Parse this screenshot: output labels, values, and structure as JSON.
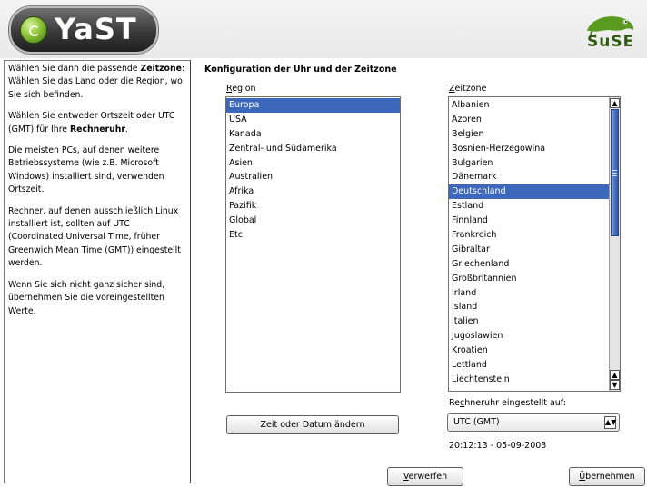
{
  "app": {
    "logo_text": "YaST",
    "brand_text": "SuSE"
  },
  "help": {
    "p1_pre": "Wählen Sie dann die passende ",
    "p1_bold": "Zeitzone",
    "p1_post": ": Wählen Sie das Land oder die Region, wo Sie sich befinden.",
    "p2_pre": "Wählen Sie entweder Ortszeit oder UTC (GMT) für Ihre ",
    "p2_bold": "Rechneruhr",
    "p2_post": ".",
    "p3": "Die meisten PCs, auf denen weitere Betriebssysteme (wie z.B. Microsoft Windows) installiert sind, verwenden Ortszeit.",
    "p4": "Rechner, auf denen ausschließlich Linux installiert ist, sollten auf UTC (Coordinated Universal Time, früher Greenwich Mean Time (GMT)) eingestellt werden.",
    "p5": "Wenn Sie sich nicht ganz sicher sind, übernehmen Sie die voreingestellten Werte."
  },
  "main": {
    "title": "Konfiguration der Uhr und der Zeitzone",
    "region_label": "Region",
    "zone_label": "Zeitzone",
    "regions": [
      "Europa",
      "USA",
      "Kanada",
      "Zentral- und Südamerika",
      "Asien",
      "Australien",
      "Afrika",
      "Pazifik",
      "Global",
      "Etc"
    ],
    "selected_region": "Europa",
    "zones": [
      "Albanien",
      "Azoren",
      "Belgien",
      "Bosnien-Herzegowina",
      "Bulgarien",
      "Dänemark",
      "Deutschland",
      "Estland",
      "Finnland",
      "Frankreich",
      "Gibraltar",
      "Griechenland",
      "Großbritannien",
      "Irland",
      "Island",
      "Italien",
      "Jugoslawien",
      "Kroatien",
      "Lettland",
      "Liechtenstein"
    ],
    "selected_zone": "Deutschland",
    "clock_label": "Rechneruhr eingestellt auf:",
    "clock_value": "UTC (GMT)",
    "datetime": "20:12:13 - 05-09-2003",
    "change_button": "Zeit oder Datum ändern",
    "discard_button": "Verwerfen",
    "accept_button": "Übernehmen"
  },
  "colors": {
    "selection": "#3d67ba",
    "brand_green": "#4f8d1b"
  }
}
